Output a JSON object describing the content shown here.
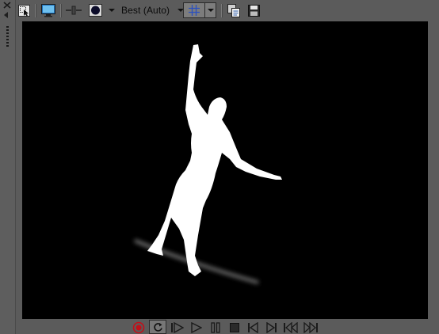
{
  "toolbar": {
    "quality_label": "Best (Auto)",
    "buttons": [
      "select-icon",
      "monitor-icon",
      "split-icon",
      "overlay-icon",
      "grid-icon",
      "copy-icon",
      "save-icon"
    ]
  },
  "transport": {
    "buttons": [
      "record-icon",
      "loop-icon",
      "play-from-start-icon",
      "play-icon",
      "pause-icon",
      "stop-icon",
      "prev-frame-icon",
      "next-frame-icon",
      "prev-marker-icon",
      "next-marker-icon"
    ]
  },
  "colors": {
    "panel": "#5b5b5b",
    "viewer_bg": "#000000",
    "grid_accent": "#2a4fc0",
    "record_red": "#c0101a"
  }
}
